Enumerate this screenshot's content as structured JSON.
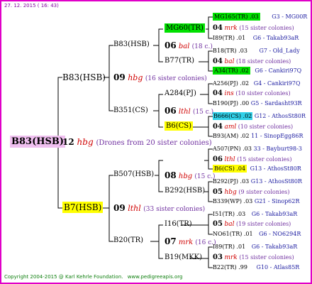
{
  "date": "27. 12. 2015 ( 16: 43)",
  "footer": {
    "copyright": "Copyright 2004-2015 @ Karl Kehrle Foundation.",
    "url": "www.pedigreeapis.org"
  },
  "root": {
    "name": "B83(HSB)",
    "gen": "12",
    "method": "hbg",
    "note": "(Drones from 20 sister colonies)"
  },
  "g1": [
    {
      "name": "B83(HSB)",
      "gen": "09",
      "method": "hbg",
      "note": "(16 sister colonies)"
    },
    {
      "name": "B7(HSB)",
      "gen": "09",
      "method": "lthl",
      "note": "(33 sister colonies)"
    }
  ],
  "g2": [
    {
      "name": "B83(HSB)",
      "gen": "06",
      "method": "bal",
      "note": "(18 c.)"
    },
    {
      "name": "B77(TR)"
    },
    {
      "name": "B351(CS)",
      "gen": "06",
      "method": "lthl",
      "note": "(15 c.)"
    },
    {
      "name": "B6(CS)"
    },
    {
      "name": "B507(HSB)",
      "gen": "08",
      "method": "hbg",
      "note": "(15 c.)"
    },
    {
      "name": "B292(HSB)"
    },
    {
      "name": "B20(TR)",
      "gen": "07",
      "method": "mrk",
      "note": "(16 c.)"
    },
    {
      "name": "B19(MKK)"
    }
  ],
  "g3": [
    {
      "name": "MG60(TR)",
      "gen": "04",
      "method": "mrk",
      "note": "(15 sister colonies)"
    },
    {
      "name": "I89(TR) .01",
      "note": "G6 - Takab93aR"
    },
    {
      "name": "B18(TR) .03",
      "note": "G7 - Old_Lady"
    },
    {
      "name": "04",
      "method": "bal",
      "note": "(18 sister colonies)"
    },
    {
      "name": "A34(TR) .02",
      "note": "G6 - Cankiri97Q"
    },
    {
      "name": "A284(PJ)",
      "gen": "04",
      "method": "ins",
      "note": "(10 sister colonies)"
    },
    {
      "name": "B190(PJ) .00",
      "note": "G5 - Sardasht93R"
    },
    {
      "name": "B666(CS) .02",
      "note": "G12 - AthosSt80R"
    },
    {
      "name": "04",
      "method": "aml",
      "note": "(10 sister colonies)"
    },
    {
      "name": "B93(AM) .02",
      "note": "11 - SinopEgg86R"
    },
    {
      "name": "A507(PN) .03",
      "note": "33 - Bayburt98-3"
    },
    {
      "name": "06",
      "method": "lthl",
      "note": "(15 sister colonies)"
    },
    {
      "name": "B6(CS) .04",
      "note": "G13 - AthosSt80R"
    },
    {
      "name": "B292(PJ) .03",
      "note": "G13 - AthosSt80R"
    },
    {
      "name": "05",
      "method": "hbg",
      "note": "(9 sister colonies)"
    },
    {
      "name": "B339(WP) .03",
      "note": "G21 - Sinop62R"
    },
    {
      "name": "I51(TR) .03",
      "note": "G6 - Takab93aR"
    },
    {
      "name": "I16(TR)",
      "gen": "05",
      "method": "bal",
      "note": "(19 sister colonies)"
    },
    {
      "name": "NO61(TR) .01",
      "note": "G6 - NO6294R"
    },
    {
      "name": "I89(TR) .01",
      "note": "G6 - Takab93aR"
    },
    {
      "name": "03",
      "method": "mrk",
      "note": "(15 sister colonies)"
    },
    {
      "name": "B22(TR) .99",
      "note": "G10 - Atlas85R"
    }
  ],
  "g4": [
    {
      "name": "MG165(TR) .03",
      "note": "G3 - MG00R"
    },
    {
      "name": "A256(PJ) .02",
      "note": "G4 - Cankiri97Q"
    }
  ]
}
